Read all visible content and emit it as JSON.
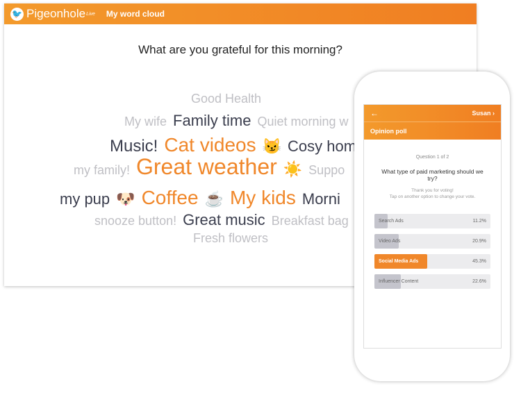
{
  "desktop": {
    "logo": "Pigeonhole",
    "logo_sup": "Live",
    "title": "My word cloud",
    "question": "What are you grateful for this morning?",
    "rows": [
      [
        {
          "t": "Good Health",
          "s": "g"
        }
      ],
      [
        {
          "t": "My wife",
          "s": "g"
        },
        {
          "t": "Family time",
          "s": "d"
        },
        {
          "t": "Quiet morning w",
          "s": "g"
        }
      ],
      [
        {
          "t": "Music!",
          "s": "d"
        },
        {
          "t": "Cat videos",
          "s": "o"
        },
        {
          "t": "😼",
          "s": "e"
        },
        {
          "t": "Cosy hom",
          "s": "d"
        }
      ],
      [
        {
          "t": "my family!",
          "s": "g"
        },
        {
          "t": "Great weather",
          "s": "o"
        },
        {
          "t": "☀️",
          "s": "e"
        },
        {
          "t": "Suppo",
          "s": "g"
        }
      ],
      [
        {
          "t": "my pup",
          "s": "d"
        },
        {
          "t": "🐶",
          "s": "e"
        },
        {
          "t": "Coffee",
          "s": "o"
        },
        {
          "t": "☕",
          "s": "e"
        },
        {
          "t": "My kids",
          "s": "o"
        },
        {
          "t": "Morni",
          "s": "d"
        }
      ],
      [
        {
          "t": "snooze button!",
          "s": "g"
        },
        {
          "t": "Great music",
          "s": "d"
        },
        {
          "t": "Breakfast bag",
          "s": "g"
        }
      ],
      [
        {
          "t": "Fresh flowers",
          "s": "g"
        }
      ]
    ]
  },
  "phone": {
    "back": "←",
    "user": "Susan ›",
    "section": "Opinion poll",
    "counter": "Question 1 of 2",
    "question": "What type of paid marketing should we try?",
    "thanks": "Thank you for voting!",
    "hint": "Tap on another option to change your vote.",
    "options": [
      {
        "label": "Search Ads",
        "pct": "11.2%",
        "value": 11.2
      },
      {
        "label": "Video Ads",
        "pct": "20.9%",
        "value": 20.9
      },
      {
        "label": "Social Media Ads",
        "pct": "45.3%",
        "value": 45.3,
        "selected": true
      },
      {
        "label": "Influencer Content",
        "pct": "22.6%",
        "value": 22.6
      }
    ]
  },
  "colors": {
    "accent": "#f0872a"
  }
}
